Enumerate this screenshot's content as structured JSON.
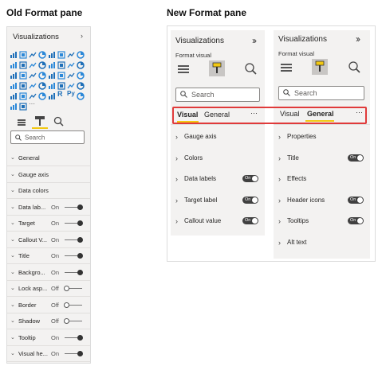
{
  "headings": {
    "old": "Old Format pane",
    "new": "New Format pane"
  },
  "old_pane": {
    "title": "Visualizations",
    "search_placeholder": "Search",
    "rows": [
      {
        "label": "General",
        "value": "",
        "slider": null
      },
      {
        "label": "Gauge axis",
        "value": "",
        "slider": null
      },
      {
        "label": "Data colors",
        "value": "",
        "slider": null
      },
      {
        "label": "Data lab...",
        "value": "On",
        "slider": "on"
      },
      {
        "label": "Target",
        "value": "On",
        "slider": "on"
      },
      {
        "label": "Callout V...",
        "value": "On",
        "slider": "on"
      },
      {
        "label": "Title",
        "value": "On",
        "slider": "on"
      },
      {
        "label": "Backgro...",
        "value": "On",
        "slider": "on"
      },
      {
        "label": "Lock asp...",
        "value": "Off",
        "slider": "off"
      },
      {
        "label": "Border",
        "value": "Off",
        "slider": "off"
      },
      {
        "label": "Shadow",
        "value": "Off",
        "slider": "off"
      },
      {
        "label": "Tooltip",
        "value": "On",
        "slider": "on"
      },
      {
        "label": "Visual he...",
        "value": "On",
        "slider": "on"
      }
    ],
    "viz_icons": {
      "r_label": "R",
      "py_label": "Py",
      "more_label": "···"
    }
  },
  "new_pane_left": {
    "title": "Visualizations",
    "subtitle": "Format visual",
    "search_placeholder": "Search",
    "tab_visual": "Visual",
    "tab_general": "General",
    "more": "···",
    "rows": [
      {
        "label": "Gauge axis",
        "toggle": false
      },
      {
        "label": "Colors",
        "toggle": false
      },
      {
        "label": "Data labels",
        "toggle": true
      },
      {
        "label": "Target label",
        "toggle": true
      },
      {
        "label": "Callout value",
        "toggle": true
      }
    ]
  },
  "new_pane_right": {
    "title": "Visualizations",
    "subtitle": "Format visual",
    "search_placeholder": "Search",
    "tab_visual": "Visual",
    "tab_general": "General",
    "more": "···",
    "rows": [
      {
        "label": "Properties",
        "toggle": false
      },
      {
        "label": "Title",
        "toggle": true
      },
      {
        "label": "Effects",
        "toggle": false
      },
      {
        "label": "Header icons",
        "toggle": true
      },
      {
        "label": "Tooltips",
        "toggle": true
      },
      {
        "label": "Alt text",
        "toggle": false
      }
    ]
  },
  "toggle_text": "On",
  "colors": {
    "accent_yellow": "#f2c811",
    "highlight_red": "#e03a3a",
    "toggle_dark": "#404040"
  }
}
